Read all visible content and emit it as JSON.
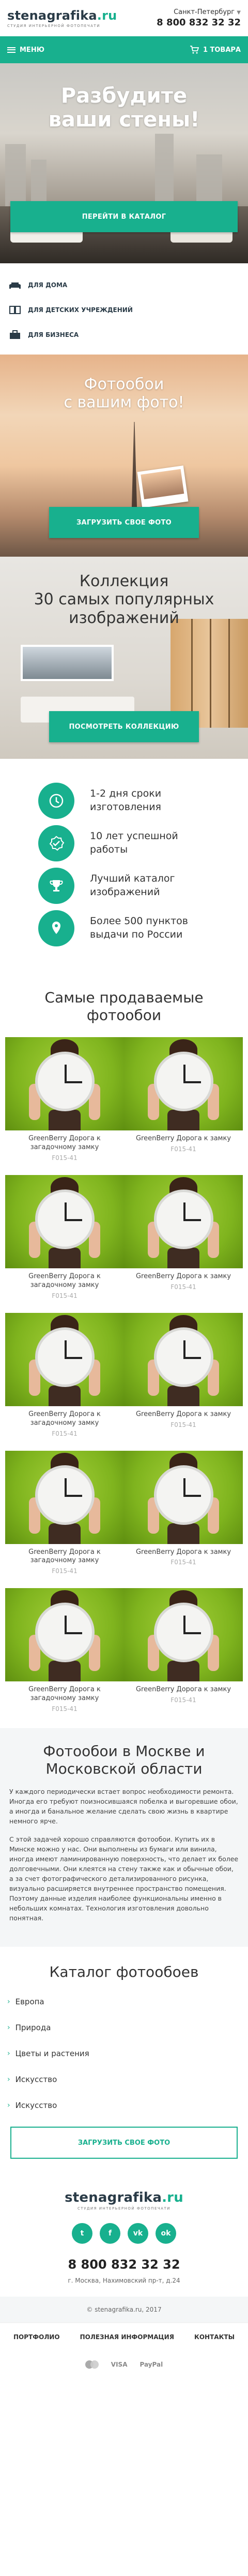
{
  "header": {
    "logo_text": "stenagrafika",
    "logo_accent": ".ru",
    "logo_tagline": "Студия интерьерной фотопечати",
    "city": "Санкт-Петербург",
    "phone": "8 800 832 32 32"
  },
  "nav": {
    "menu_label": "МЕНЮ",
    "cart_label": "1 ТОВАРА"
  },
  "hero": {
    "title_line1": "Разбудите",
    "title_line2": "ваши стены!",
    "button": "ПЕРЕЙТИ В КАТАЛОГ"
  },
  "categories": [
    {
      "label": "ДЛЯ ДОМА",
      "icon": "sofa-icon"
    },
    {
      "label": "ДЛЯ ДЕТСКИХ УЧРЕЖДЕНИЙ",
      "icon": "book-icon"
    },
    {
      "label": "ДЛЯ БИЗНЕСА",
      "icon": "briefcase-icon"
    }
  ],
  "promo_photo": {
    "title_line1": "Фотообои",
    "title_line2": "с вашим фото!",
    "button": "ЗАГРУЗИТЬ СВОЕ ФОТО"
  },
  "promo_collection": {
    "title_line1": "Коллекция",
    "title_line2": "30 самых популярных",
    "title_line3": "изображений",
    "button": "ПОСМОТРЕТЬ КОЛЛЕКЦИЮ"
  },
  "features": [
    {
      "line1": "1-2 дня сроки",
      "line2": "изготовления",
      "icon": "clock-icon"
    },
    {
      "line1": "10 лет успешной",
      "line2": "работы",
      "icon": "check-badge-icon"
    },
    {
      "line1": "Лучший каталог",
      "line2": "изображений",
      "icon": "trophy-icon"
    },
    {
      "line1": "Более 500 пунктов",
      "line2": "выдачи по России",
      "icon": "location-pin-icon"
    }
  ],
  "best_sellers": {
    "title_line1": "Самые продаваемые",
    "title_line2": "фотообои",
    "products": [
      {
        "name": "GreenBerry Дорога к загадочному замку",
        "code": "F015-41"
      },
      {
        "name": "GreenBerry Дорога к замку",
        "code": "F015-41"
      },
      {
        "name": "GreenBerry Дорога к загадочному замку",
        "code": "F015-41"
      },
      {
        "name": "GreenBerry Дорога к замку",
        "code": "F015-41"
      },
      {
        "name": "GreenBerry Дорога к загадочному замку",
        "code": "F015-41"
      },
      {
        "name": "GreenBerry Дорога к замку",
        "code": "F015-41"
      },
      {
        "name": "GreenBerry Дорога к загадочному замку",
        "code": "F015-41"
      },
      {
        "name": "GreenBerry Дорога к замку",
        "code": "F015-41"
      },
      {
        "name": "GreenBerry Дорога к загадочному замку",
        "code": "F015-41"
      },
      {
        "name": "GreenBerry Дорога к замку",
        "code": "F015-41"
      }
    ]
  },
  "text_section": {
    "title_line1": "Фотообои в Москве и",
    "title_line2": "Московской области",
    "p1": "У каждого периодически встает вопрос необходимости ремонта. Иногда его требуют поизносившаяся побелка и выгоревшие обои, а иногда и банальное желание сделать свою жизнь в квартире немного ярче.",
    "p2": "С этой задачей хорошо справляются фотообои. Купить их в Минске можно у нас. Они выполнены из бумаги или винила, иногда имеют ламинированную поверхность, что делает их более долговечными. Они клеятся на стену также как и обычные обои, а за счет фотографического детализированного рисунка, визуально расширяется внутреннее пространство помещения. Поэтому данные изделия наиболее функциональны именно в небольших комнатах. Технология изготовления довольно понятная."
  },
  "catalog": {
    "title": "Каталог фотообоев",
    "items": [
      "Европа",
      "Природа",
      "Цветы и растения",
      "Искусство",
      "Искусство"
    ],
    "upload_button": "ЗАГРУЗИТЬ СВОЕ ФОТО"
  },
  "footer": {
    "logo_text": "stenagrafika",
    "logo_accent": ".ru",
    "logo_tagline": "Студия интерьерной фотопечати",
    "socials": [
      {
        "glyph": "t",
        "icon": "twitter-icon"
      },
      {
        "glyph": "f",
        "icon": "facebook-icon"
      },
      {
        "glyph": "vk",
        "icon": "vk-icon"
      },
      {
        "glyph": "ok",
        "icon": "odnoklassniki-icon"
      }
    ],
    "phone": "8 800 832 32 32",
    "address": "г. Москва, Нахимовский пр-т, д.24",
    "copyright": "© stenagrafika.ru, 2017",
    "links": [
      "ПОРТФОЛИО",
      "ПОЛЕЗНАЯ ИНФОРМАЦИЯ",
      "КОНТАКТЫ"
    ],
    "payments": [
      "VISA",
      "PayPal"
    ]
  },
  "colors": {
    "accent": "#18b08e",
    "dark": "#2a3b47"
  }
}
